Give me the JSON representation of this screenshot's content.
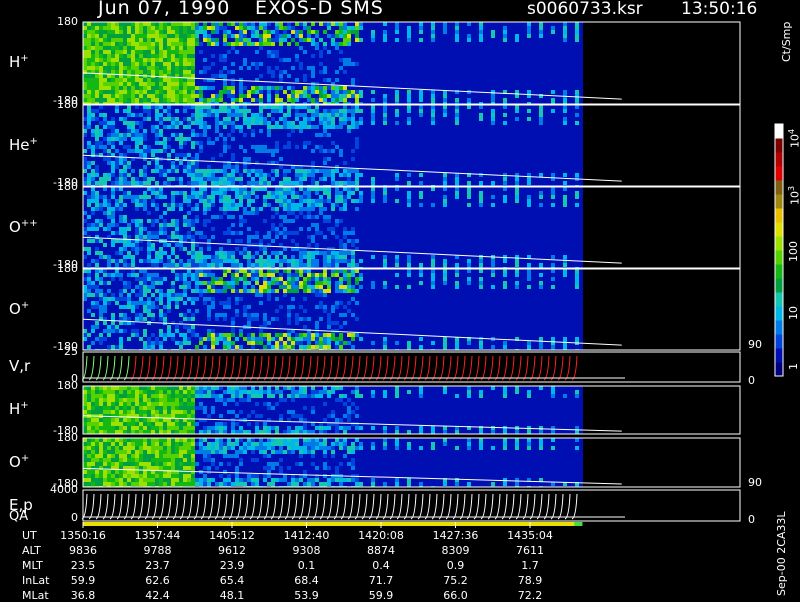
{
  "header": {
    "date": "Jun 07, 1990",
    "instrument": "EXOS-D SMS",
    "file": "s0060733.ksr",
    "time": "13:50:16"
  },
  "side_note": "Sep-00 2CA33L",
  "chart_data": {
    "type": "heatmap",
    "x": {
      "label": "UT",
      "ticks": [
        "1350:16",
        "1357:44",
        "1405:12",
        "1412:40",
        "1420:08",
        "1427:36",
        "1435:04"
      ],
      "data_end_fraction": 0.76
    },
    "panels": [
      {
        "id": "h-plus-angle",
        "label": "H",
        "charge": "+",
        "ymax": "180",
        "ymin": "-180"
      },
      {
        "id": "he-plus-angle",
        "label": "He",
        "charge": "+",
        "ymax": "180",
        "ymin": "-180"
      },
      {
        "id": "o-plusplus-angle",
        "label": "O",
        "charge": "++",
        "ymax": "180",
        "ymin": "-180"
      },
      {
        "id": "o-plus-angle",
        "label": "O",
        "charge": "+",
        "ymax": "180",
        "ymin": "-180"
      },
      {
        "id": "vr",
        "label": "V,r",
        "charge": "",
        "ymax": "25",
        "ymin": "0",
        "right_max": "90",
        "right_min": "0"
      },
      {
        "id": "h-plus-2",
        "label": "H",
        "charge": "+",
        "ymax": "180",
        "ymin": "-180"
      },
      {
        "id": "o-plus-2",
        "label": "O",
        "charge": "+",
        "ymax": "180",
        "ymin": "-180"
      },
      {
        "id": "ep",
        "label": "E,p",
        "charge": "",
        "ymax": "4000",
        "ymin": "0",
        "right_max": "90",
        "right_min": "0"
      }
    ],
    "qa_label": "QA",
    "colorbar": {
      "unit": "Ct/Smp",
      "scale": "log",
      "labels": [
        {
          "base": "1",
          "exp": ""
        },
        {
          "base": "10",
          "exp": ""
        },
        {
          "base": "100",
          "exp": ""
        },
        {
          "base": "10",
          "exp": "3"
        },
        {
          "base": "10",
          "exp": "4"
        }
      ],
      "colors": [
        "#00007c",
        "#000fb2",
        "#0044dd",
        "#007ce8",
        "#00b8e8",
        "#16c7b0",
        "#00a040",
        "#14b814",
        "#56d200",
        "#9ee000",
        "#e0e000",
        "#e8c000",
        "#a08810",
        "#806010",
        "#e00000",
        "#b00000",
        "#7a0000",
        "#ffffff"
      ]
    },
    "ephemeris": [
      {
        "label": "UT",
        "values": [
          "1350:16",
          "1357:44",
          "1405:12",
          "1412:40",
          "1420:08",
          "1427:36",
          "1435:04"
        ]
      },
      {
        "label": "ALT",
        "values": [
          "9836",
          "9788",
          "9612",
          "9308",
          "8874",
          "8309",
          "7611"
        ]
      },
      {
        "label": "MLT",
        "values": [
          "23.5",
          "23.7",
          "23.9",
          "0.1",
          "0.4",
          "0.9",
          "1.7"
        ]
      },
      {
        "label": "InLat",
        "values": [
          "59.9",
          "62.6",
          "65.4",
          "68.4",
          "71.7",
          "75.2",
          "78.9"
        ]
      },
      {
        "label": "MLat",
        "values": [
          "36.8",
          "42.4",
          "48.1",
          "53.9",
          "59.9",
          "66.0",
          "72.2"
        ]
      }
    ]
  }
}
